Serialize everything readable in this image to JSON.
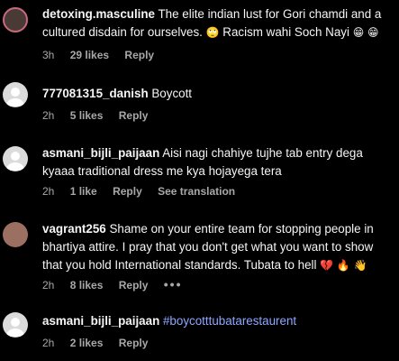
{
  "comments": [
    {
      "username": "detoxing.masculine",
      "text": "The elite indian lust for Gori chamdi and a cultured disdain for ourselves.",
      "text_after_emoji": " Racism wahi Soch Nayi",
      "emojis": [
        "🙄",
        "😁",
        "😁"
      ],
      "time": "3h",
      "likes": "29 likes",
      "reply": "Reply"
    },
    {
      "username": "777081315_danish",
      "text": "Boycott",
      "time": "2h",
      "likes": "5 likes",
      "reply": "Reply"
    },
    {
      "username": "asmani_bijli_paijaan",
      "text": "Aisi nagi chahiye tujhe tab entry dega kyaaa traditional dress me kya hojayega tera",
      "time": "2h",
      "likes": "1 like",
      "reply": "Reply",
      "translate": "See translation"
    },
    {
      "username": "vagrant256",
      "text": "Shame on your entire team for stopping people in bhartiya attire. I pray that you don't get what you want to show that you hold International standards. Tubata to hell",
      "emojis": [
        "💔",
        "🔥",
        "👋"
      ],
      "time": "2h",
      "likes": "8 likes",
      "reply": "Reply",
      "more": "•••"
    },
    {
      "username": "asmani_bijli_paijaan",
      "hashtag": "#boycotttubatarestaurent",
      "time": "2h",
      "likes": "2 likes",
      "reply": "Reply"
    }
  ],
  "colors": {
    "background": "#000000",
    "text": "#f5f5f5",
    "meta": "#a8a8a8",
    "hashtag": "#8ea7ff",
    "avatar_placeholder": "#dbdbdb"
  }
}
